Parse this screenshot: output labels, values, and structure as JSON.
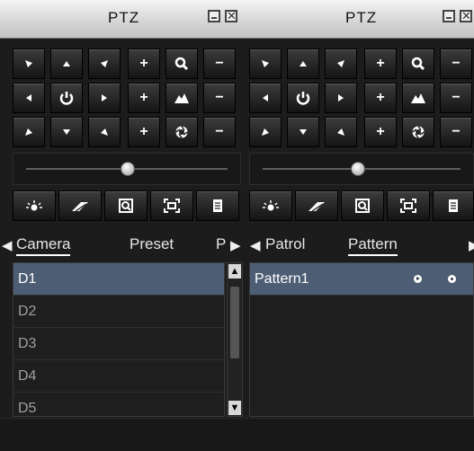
{
  "left_panel": {
    "title": "PTZ",
    "close_glyph": "✕",
    "tabs": {
      "camera": "Camera",
      "preset": "Preset",
      "partial": "P"
    },
    "list": [
      "D1",
      "D2",
      "D3",
      "D4",
      "D5"
    ],
    "scroll_up": "▲",
    "scroll_down": "▼"
  },
  "right_panel": {
    "title": "PTZ",
    "close_glyph": "✕",
    "tabs": {
      "patrol": "Patrol",
      "pattern": "Pattern"
    },
    "list": [
      "Pattern1"
    ]
  },
  "buttons": {
    "plus": "+",
    "minus": "−",
    "arrow_left": "◀",
    "arrow_right": "▶"
  },
  "icons": {
    "direction": [
      "up-left-arrow-icon",
      "up-arrow-icon",
      "up-right-arrow-icon",
      "left-arrow-icon",
      "auto-rotate-icon",
      "right-arrow-icon",
      "down-left-arrow-icon",
      "down-arrow-icon",
      "down-right-arrow-icon"
    ],
    "lens": [
      "zoom-icon",
      "focus-icon",
      "iris-icon"
    ],
    "toolbar": [
      "light-icon",
      "wiper-icon",
      "3d-zoom-icon",
      "lens-init-icon",
      "menu-icon"
    ]
  },
  "colors": {
    "selected_row": "#4d5e74",
    "title_bar": "#d7d7d7",
    "background": "#1c1c1c"
  }
}
